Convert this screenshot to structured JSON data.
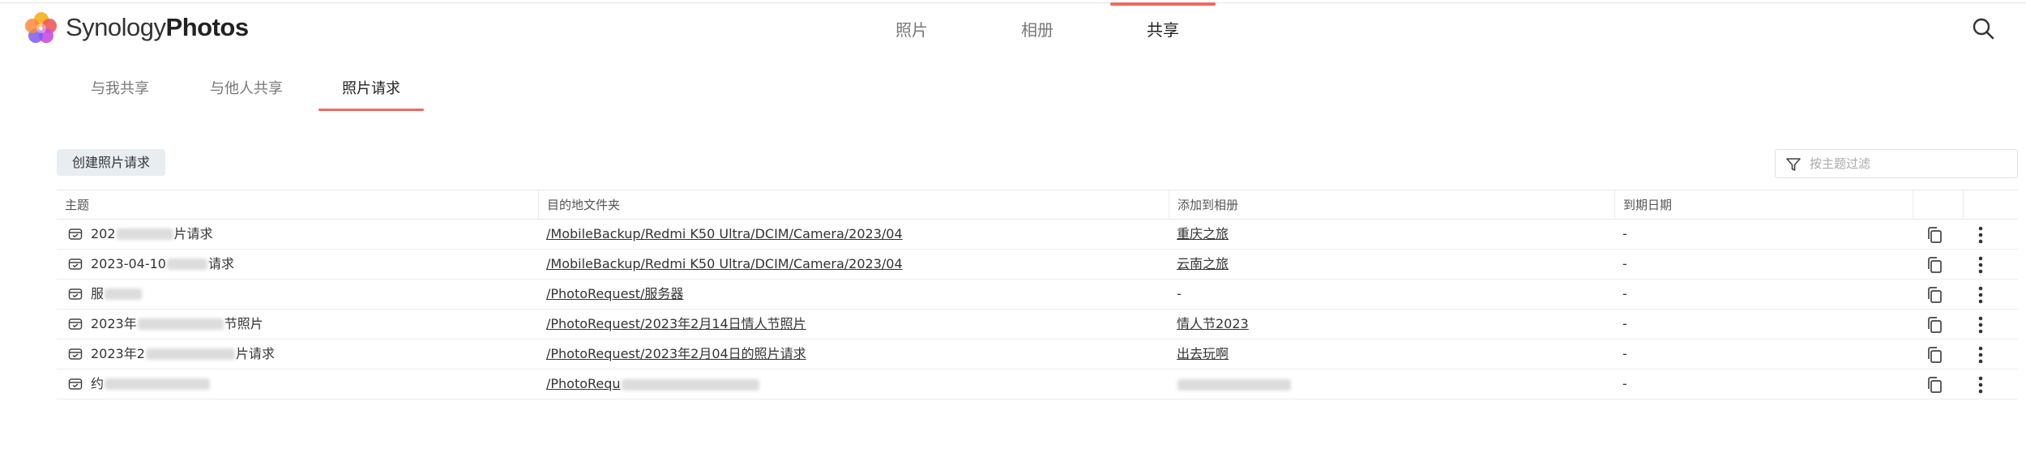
{
  "app": {
    "brand_light": "Synology",
    "brand_bold": "Photos"
  },
  "main_tabs": [
    {
      "label": "照片",
      "active": false
    },
    {
      "label": "相册",
      "active": false
    },
    {
      "label": "共享",
      "active": true
    }
  ],
  "sub_tabs": [
    {
      "label": "与我共享",
      "active": false
    },
    {
      "label": "与他人共享",
      "active": false
    },
    {
      "label": "照片请求",
      "active": true
    }
  ],
  "toolbar": {
    "create_label": "创建照片请求",
    "filter_placeholder": "按主题过滤"
  },
  "table": {
    "headers": [
      "主题",
      "目的地文件夹",
      "添加到相册",
      "到期日期"
    ],
    "rows": [
      {
        "subject_a": "202",
        "subject_b": "片请求",
        "folder": "/MobileBackup/Redmi K50 Ultra/DCIM/Camera/2023/04",
        "album": "重庆之旅",
        "expiry": "-"
      },
      {
        "subject_a": "2023-04-10",
        "subject_b": "请求",
        "folder": "/MobileBackup/Redmi K50 Ultra/DCIM/Camera/2023/04",
        "album": "云南之旅",
        "expiry": "-"
      },
      {
        "subject_a": "服",
        "subject_b": "",
        "folder": "/PhotoRequest/服务器",
        "album": "-",
        "expiry": "-"
      },
      {
        "subject_a": "2023年",
        "subject_b": "节照片",
        "folder": "/PhotoRequest/2023年2月14日情人节照片",
        "album": "情人节2023",
        "expiry": "-"
      },
      {
        "subject_a": "2023年2",
        "subject_b": "片请求",
        "folder": "/PhotoRequest/2023年2月04日的照片请求",
        "album": "出去玩啊",
        "expiry": "-"
      },
      {
        "subject_a": "约",
        "subject_b": "",
        "folder": "/PhotoRequ",
        "album": "",
        "expiry": "-"
      }
    ]
  },
  "colors": {
    "accent": "#f0685e",
    "button_bg": "#e8edf2"
  },
  "icons": {
    "logo": "synology-photos-logo",
    "search": "search-icon",
    "filter": "filter-icon",
    "request": "photo-request-icon",
    "copy": "copy-link-icon",
    "more": "more-vertical-icon"
  }
}
